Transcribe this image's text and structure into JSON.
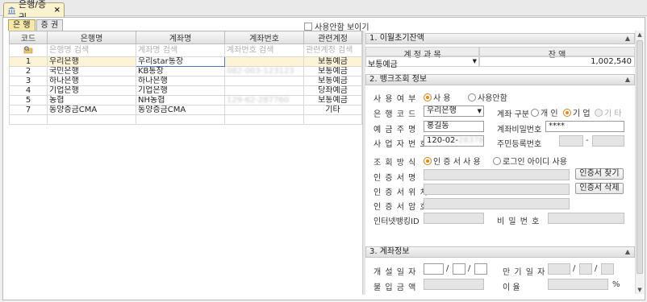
{
  "window": {
    "tab_label": "은행/증권",
    "tab_close": "×"
  },
  "subtabs": [
    "은 행",
    "증 권"
  ],
  "show_unused_label": "사용안함 보이기",
  "grid": {
    "columns": [
      "코드",
      "은행명",
      "계좌명",
      "계좌번호",
      "관련계정"
    ],
    "filter": [
      "은행명 검색",
      "계좌명 검색",
      "계좌번호 검색",
      "관련계정 검색"
    ],
    "rows": [
      {
        "code": "1",
        "bank": "우리은행",
        "account_name": "우리star통장",
        "account_no": "",
        "related": "보통예금"
      },
      {
        "code": "2",
        "bank": "국민은행",
        "account_name": "KB통장",
        "account_no": "082-003-123123",
        "related": "보통예금"
      },
      {
        "code": "3",
        "bank": "하나은행",
        "account_name": "하나은행",
        "account_no": "",
        "related": "보통예금"
      },
      {
        "code": "4",
        "bank": "기업은행",
        "account_name": "기업은행",
        "account_no": "",
        "related": "당좌예금"
      },
      {
        "code": "5",
        "bank": "농협",
        "account_name": "NH농협",
        "account_no": "129-62-287760",
        "related": "보통예금"
      },
      {
        "code": "7",
        "bank": "동양증금CMA",
        "account_name": "동양증금CMA",
        "account_no": "",
        "related": "기타"
      }
    ]
  },
  "section1": {
    "title": "1. 이월초기잔액",
    "col_account": "계 정 과 목",
    "col_balance": "잔      액",
    "account": "보통예금",
    "balance": "1,002,540"
  },
  "section2": {
    "title": "2. 뱅크조회 정보",
    "use_label": "사 용 여 부",
    "use_yes": "사 용",
    "use_no": "사용안함",
    "bank_code_label": "은 행 코 드",
    "bank_code_value": "우리은행",
    "acct_type_label": "계좌 구분",
    "acct_personal": "개 인",
    "acct_corp": "기 업",
    "acct_other": "기 타",
    "holder_label": "예 금 주 명",
    "holder_value": "홍길동",
    "acct_pw_label": "계좌비밀번호",
    "acct_pw_value": "****",
    "bizno_label": "사 업 자 번 호",
    "bizno_value": "120-02-",
    "bizno_blur": "28378",
    "ssn_label": "주민등록번호",
    "ssn_sep": "-",
    "method_label": "조 회 방 식",
    "method_cert": "인 증 서 사 용",
    "method_login": "로그인 아이디 사용",
    "cert_name_label": "인 증 서 명",
    "cert_find": "인증서 찾기",
    "cert_loc_label": "인 증 서 위 치",
    "cert_delete": "인증서 삭제",
    "cert_pw_label": "인 증 서 암 호",
    "ibank_id_label": "인터넷뱅킹ID",
    "pw_label": "비 밀 번 호"
  },
  "section3": {
    "title": "3. 계좌정보",
    "open_date_label": "개 설 일 자",
    "maturity_label": "만 기 일 자",
    "deposit_label": "불 입 금 액",
    "rate_label": "이          율",
    "slash": "/",
    "percent": "%"
  }
}
